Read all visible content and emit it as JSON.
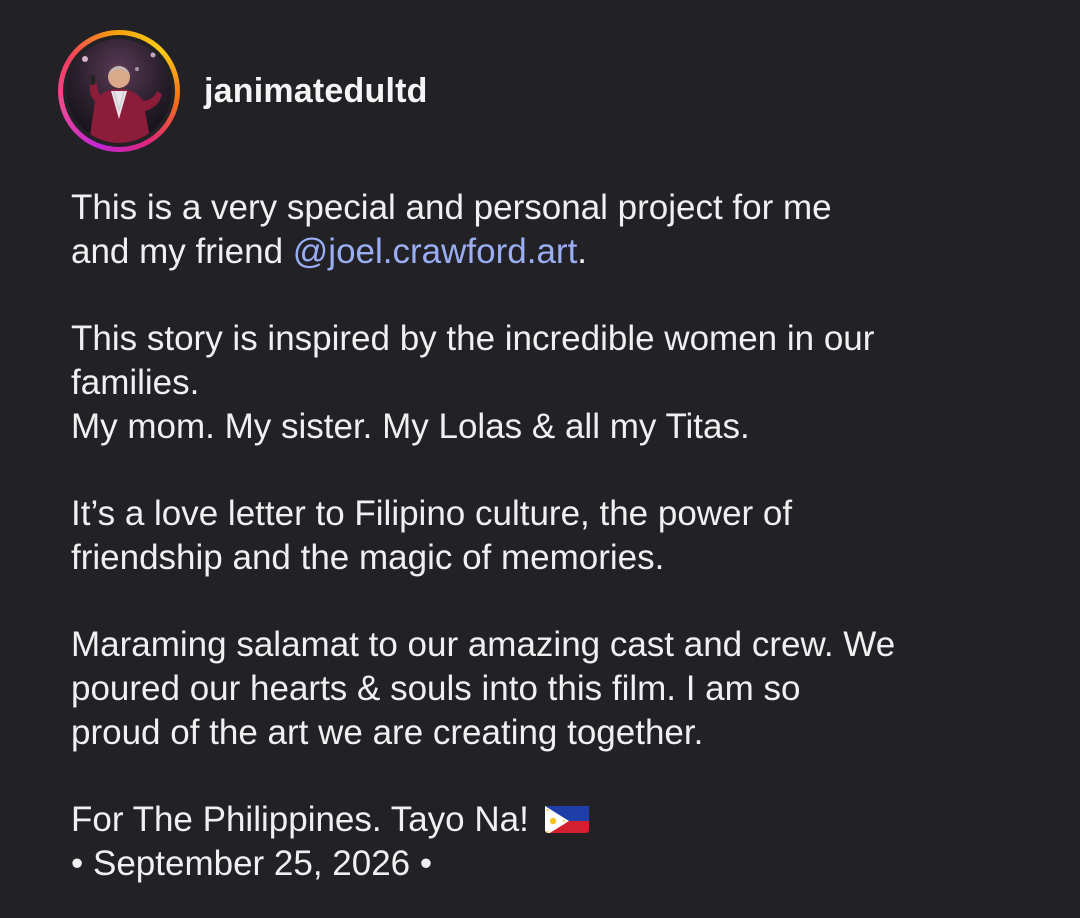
{
  "post": {
    "username": "janimatedultd",
    "avatar_icon": "profile-photo-avatar",
    "ring_colors": [
      "#c026d3",
      "#ec4899",
      "#f59e0b",
      "#facc15"
    ],
    "caption": {
      "p1_line1": "This is a very special and personal project for me",
      "p1_line2_prefix": "and my friend ",
      "mention": "@joel.crawford.art",
      "p1_line2_suffix": ".",
      "p2_line1": "This story is inspired by the incredible women in our",
      "p2_line2": "families.",
      "p2_line3": "My mom. My sister. My Lolas & all my Titas.",
      "p3_line1": "It’s a love letter to Filipino culture, the power of",
      "p3_line2": "friendship and the magic of memories.",
      "p4_line1": "Maraming salamat to our amazing cast and crew. We",
      "p4_line2": "poured our hearts & souls into this film. I am so",
      "p4_line3": "proud of the art we are creating together.",
      "p5_line1": "For The Philippines. Tayo Na! ",
      "flag_icon": "philippines-flag-icon",
      "date_line": "• September 25, 2026 •"
    },
    "colors": {
      "background": "#212126",
      "text": "#f0f0f0",
      "mention": "#9aaef5"
    }
  }
}
